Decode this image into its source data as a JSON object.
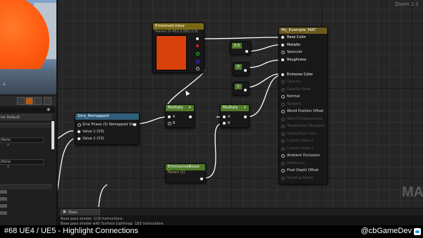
{
  "graph": {
    "zoom_label": "Zoom 1:1",
    "watermark": "MATERIAL"
  },
  "left_panel": {
    "section_label": "ter Default",
    "field_a": "None",
    "field_b": "None",
    "gizmo_label": "⊥"
  },
  "nodes": {
    "emissive_colour": {
      "title": "EmissiveColour",
      "subtitle": "Param (0.452,0.081,0.0)",
      "swatch_color": "#d8400c",
      "header_color": "#7a6a14"
    },
    "my_example_mat": {
      "title": "My_Example_MAT",
      "header_color": "#6b5a1e",
      "inputs": [
        {
          "label": "Base Color",
          "state": "connected"
        },
        {
          "label": "Metallic",
          "state": "connected"
        },
        {
          "label": "Specular",
          "state": "open"
        },
        {
          "label": "Roughness",
          "state": "connected"
        },
        {
          "label": "",
          "state": "spacer"
        },
        {
          "label": "Emissive Color",
          "state": "connected"
        },
        {
          "label": "Opacity",
          "state": "dim"
        },
        {
          "label": "Opacity Mask",
          "state": "dim"
        },
        {
          "label": "Normal",
          "state": "open"
        },
        {
          "label": "Tangent",
          "state": "dim"
        },
        {
          "label": "World Position Offset",
          "state": "open"
        },
        {
          "label": "World Displacement",
          "state": "dim"
        },
        {
          "label": "Tessellation Multiplier",
          "state": "dim"
        },
        {
          "label": "Subsurface Color",
          "state": "dim"
        },
        {
          "label": "Custom Data 0",
          "state": "dim"
        },
        {
          "label": "Custom Data 1",
          "state": "dim"
        },
        {
          "label": "Ambient Occlusion",
          "state": "open"
        },
        {
          "label": "Refraction",
          "state": "dim"
        },
        {
          "label": "Pixel Depth Offset",
          "state": "open"
        },
        {
          "label": "Shading Model",
          "state": "dim"
        }
      ]
    },
    "const_metallic": {
      "value": "0.5",
      "header_color": "#4f7a2a"
    },
    "const_0": {
      "value": "0",
      "header_color": "#4f7a2a"
    },
    "const_1": {
      "value": "1",
      "header_color": "#4f7a2a"
    },
    "sine_remapped": {
      "title": "Sine_Remapped",
      "header_color": "#2f5f7a",
      "inputs": [
        "Sine Phase (S) Remapped Sine",
        "Value 1 (V3)",
        "Value 2 (V3)"
      ]
    },
    "multiply_1": {
      "title": "Multiply",
      "header_color": "#4f7a2a",
      "a": "A",
      "b": "B"
    },
    "multiply_2": {
      "title": "Multiply",
      "header_color": "#4f7a2a",
      "a": "A",
      "b": "B"
    },
    "emissive_boost": {
      "title": "EmmissiveBoost",
      "subtitle": "Param (1)",
      "header_color": "#4f7a2a"
    }
  },
  "stats": {
    "tab_label": "Stats",
    "lines": [
      "Base pass shader: 119 instructions",
      "Base pass shader with Surface Lightmap: 183 instructions"
    ]
  },
  "caption": {
    "left": "#68 UE4 / UE5 - Highlight Connections",
    "right": "@cbGameDev"
  },
  "colors": {
    "wire": "#ffffff",
    "caption_bg": "#000000"
  }
}
